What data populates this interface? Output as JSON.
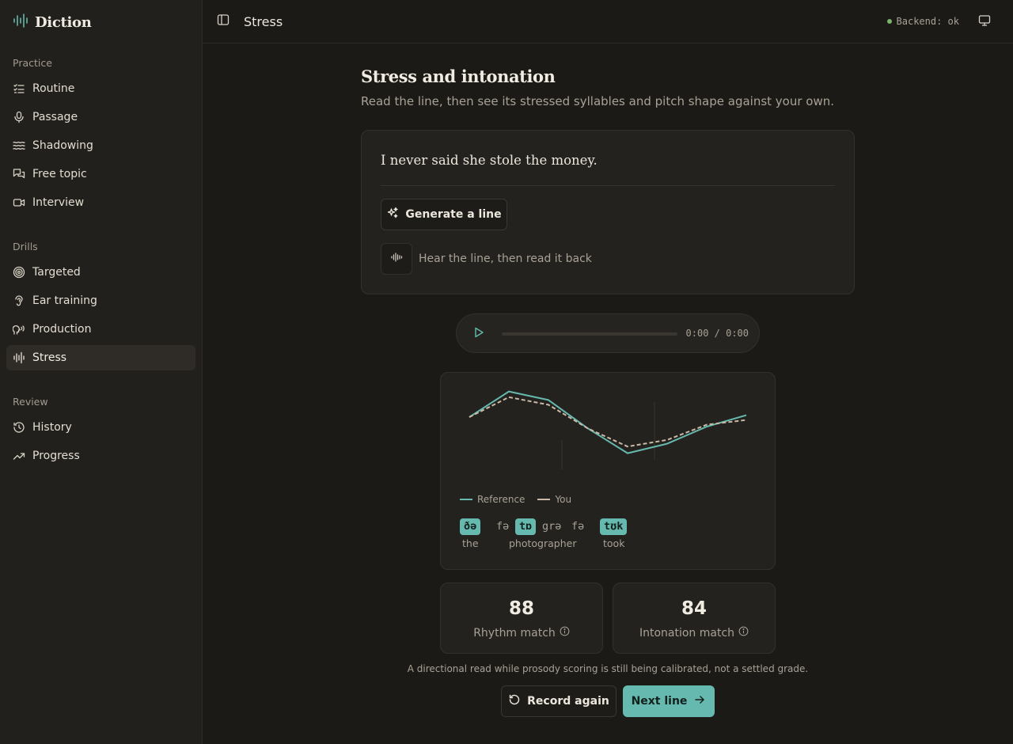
{
  "app": {
    "name": "Diction"
  },
  "sidebar": {
    "sections": [
      {
        "label": "Practice",
        "items": [
          {
            "label": "Routine",
            "icon": "list-check-icon"
          },
          {
            "label": "Passage",
            "icon": "microphone-icon"
          },
          {
            "label": "Shadowing",
            "icon": "waves-icon"
          },
          {
            "label": "Free topic",
            "icon": "chat-bubbles-icon"
          },
          {
            "label": "Interview",
            "icon": "video-camera-icon"
          }
        ]
      },
      {
        "label": "Drills",
        "items": [
          {
            "label": "Targeted",
            "icon": "target-icon"
          },
          {
            "label": "Ear training",
            "icon": "ear-icon"
          },
          {
            "label": "Production",
            "icon": "speaking-head-icon"
          },
          {
            "label": "Stress",
            "icon": "audio-waveform-icon",
            "active": true
          }
        ]
      },
      {
        "label": "Review",
        "items": [
          {
            "label": "History",
            "icon": "history-icon"
          },
          {
            "label": "Progress",
            "icon": "trending-up-icon"
          }
        ]
      }
    ]
  },
  "topbar": {
    "title": "Stress",
    "backend_status": "Backend: ok",
    "status_color": "#7bb36a"
  },
  "main": {
    "title": "Stress and intonation",
    "subtitle": "Read the line, then see its stressed syllables and pitch shape against your own.",
    "line": "I never said she stole the money.",
    "generate_label": "Generate a line",
    "hear_label": "Hear the line, then read it back"
  },
  "player": {
    "time": "0:00 / 0:00"
  },
  "chart_data": {
    "type": "line",
    "x": [
      0,
      1,
      2,
      3,
      4,
      5,
      6,
      7
    ],
    "series": [
      {
        "name": "Reference",
        "color": "#66b9ae",
        "values": [
          0.7,
          0.97,
          0.88,
          0.58,
          0.32,
          0.42,
          0.6,
          0.72
        ]
      },
      {
        "name": "You",
        "color": "#c9b9a6",
        "values": [
          0.7,
          0.91,
          0.83,
          0.58,
          0.39,
          0.46,
          0.62,
          0.67
        ]
      }
    ],
    "legend": [
      "Reference",
      "You"
    ],
    "legend_position": "bottom-left",
    "syllables": [
      {
        "text": "ðə",
        "stressed": true
      },
      {
        "text": "fə",
        "stressed": false
      },
      {
        "text": "tɒ",
        "stressed": true
      },
      {
        "text": "grə",
        "stressed": false
      },
      {
        "text": "fə",
        "stressed": false
      },
      {
        "text": "tʊk",
        "stressed": true
      }
    ],
    "words": [
      "the",
      "photographer",
      "took"
    ]
  },
  "metrics": [
    {
      "value": "88",
      "label": "Rhythm match"
    },
    {
      "value": "84",
      "label": "Intonation match"
    }
  ],
  "disclaimer": "A directional read while prosody scoring is still being calibrated, not a settled grade.",
  "actions": {
    "record_again": "Record again",
    "next_line": "Next line"
  },
  "accent_color": "#66b9ae"
}
